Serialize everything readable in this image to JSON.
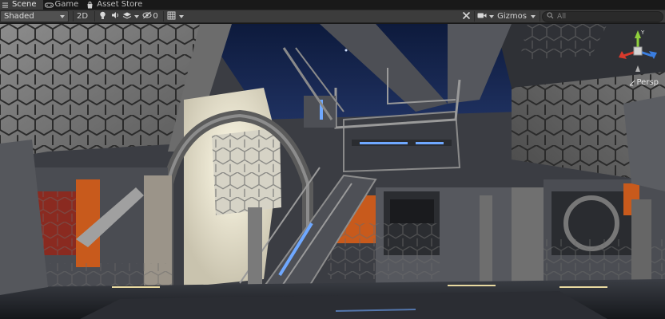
{
  "tabs": [
    {
      "label": "Scene",
      "icon": "scene-icon",
      "active": true
    },
    {
      "label": "Game",
      "icon": "game-controller-icon",
      "active": false
    },
    {
      "label": "Asset Store",
      "icon": "asset-store-bag-icon",
      "active": false
    }
  ],
  "toolbar": {
    "shading_mode": "Shaded",
    "mode_2d": "2D",
    "hidden_count": "0",
    "gizmos_label": "Gizmos",
    "search_placeholder": "All"
  },
  "gizmo": {
    "projection_label": "Persp",
    "axes": {
      "y": "Y",
      "x": "X",
      "z": "Z"
    }
  },
  "colors": {
    "window_bg": "#191919",
    "toolbar_bg": "#3c3c3c",
    "active_tab_bg": "#3c3c3c",
    "gizmo_x": "#d83a2c",
    "gizmo_y": "#8fcf3c",
    "gizmo_z": "#3a7ee0",
    "scene_glow": "#6fa8ff",
    "scene_orange": "#c85a1c"
  }
}
